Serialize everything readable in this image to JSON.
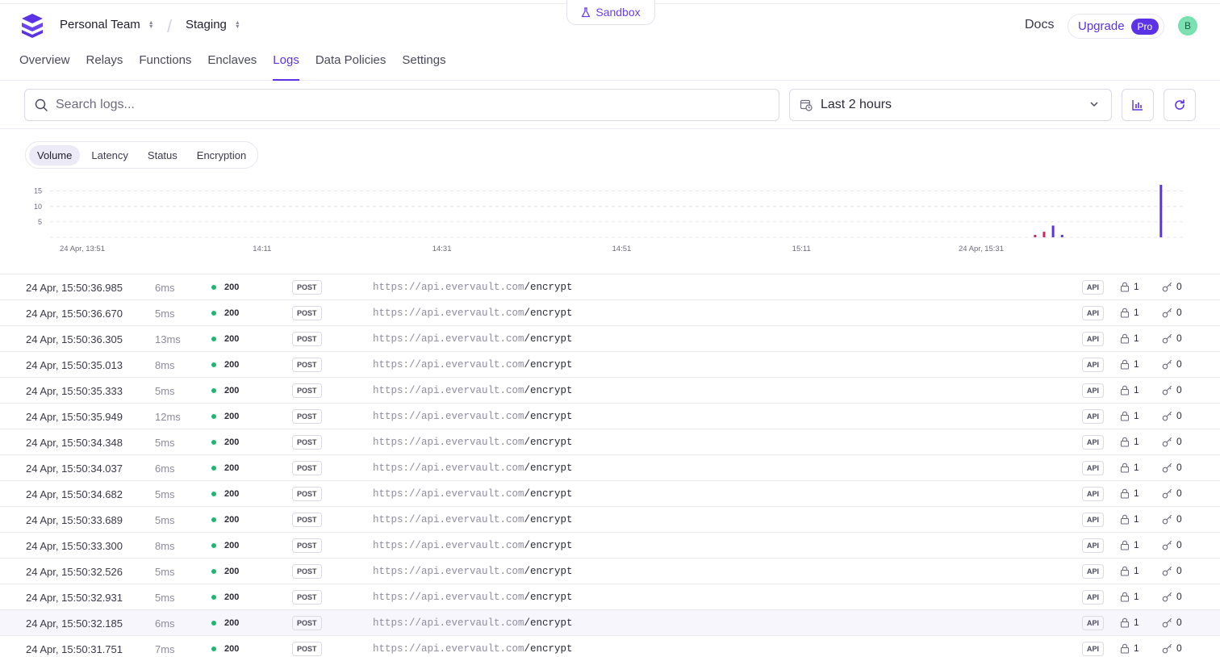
{
  "environment_badge": "Sandbox",
  "header": {
    "team": "Personal Team",
    "separator": "/",
    "env": "Staging",
    "docs": "Docs",
    "upgrade": "Upgrade",
    "pro": "Pro",
    "avatar_initial": "B"
  },
  "nav": {
    "tabs": [
      {
        "label": "Overview"
      },
      {
        "label": "Relays"
      },
      {
        "label": "Functions"
      },
      {
        "label": "Enclaves"
      },
      {
        "label": "Logs"
      },
      {
        "label": "Data Policies"
      },
      {
        "label": "Settings"
      }
    ],
    "active": "Logs"
  },
  "toolbar": {
    "search_placeholder": "Search logs...",
    "range": "Last 2 hours"
  },
  "metric_tabs": {
    "tabs": [
      "Volume",
      "Latency",
      "Status",
      "Encryption"
    ],
    "active": "Volume"
  },
  "chart_data": {
    "type": "bar",
    "y_ticks": [
      "15",
      "10",
      "5"
    ],
    "x_ticks": [
      "24 Apr, 13:51",
      "14:11",
      "14:31",
      "14:51",
      "15:11",
      "24 Apr, 15:31"
    ],
    "ylim": [
      0,
      17
    ],
    "grid": true,
    "colors": {
      "primary": "#5b32e6",
      "error": "#d2255f"
    },
    "bars": [
      {
        "time": "15:37",
        "value": 0.8,
        "color": "error"
      },
      {
        "time": "15:38",
        "value": 1.8,
        "color": "error"
      },
      {
        "time": "15:39",
        "value": 3.8,
        "color": "primary"
      },
      {
        "time": "15:40",
        "value": 0.8,
        "color": "primary"
      },
      {
        "time": "15:51",
        "value": 17,
        "color": "primary"
      }
    ]
  },
  "logs": {
    "host": "https://api.evervault.com",
    "rows": [
      {
        "time": "24 Apr, 15:50:36.985",
        "latency": "6ms",
        "status": "200",
        "method": "POST",
        "path": "/encrypt",
        "source": "API",
        "encrypted": "1",
        "decrypted": "0"
      },
      {
        "time": "24 Apr, 15:50:36.670",
        "latency": "5ms",
        "status": "200",
        "method": "POST",
        "path": "/encrypt",
        "source": "API",
        "encrypted": "1",
        "decrypted": "0"
      },
      {
        "time": "24 Apr, 15:50:36.305",
        "latency": "13ms",
        "status": "200",
        "method": "POST",
        "path": "/encrypt",
        "source": "API",
        "encrypted": "1",
        "decrypted": "0"
      },
      {
        "time": "24 Apr, 15:50:35.013",
        "latency": "8ms",
        "status": "200",
        "method": "POST",
        "path": "/encrypt",
        "source": "API",
        "encrypted": "1",
        "decrypted": "0"
      },
      {
        "time": "24 Apr, 15:50:35.333",
        "latency": "5ms",
        "status": "200",
        "method": "POST",
        "path": "/encrypt",
        "source": "API",
        "encrypted": "1",
        "decrypted": "0"
      },
      {
        "time": "24 Apr, 15:50:35.949",
        "latency": "12ms",
        "status": "200",
        "method": "POST",
        "path": "/encrypt",
        "source": "API",
        "encrypted": "1",
        "decrypted": "0"
      },
      {
        "time": "24 Apr, 15:50:34.348",
        "latency": "5ms",
        "status": "200",
        "method": "POST",
        "path": "/encrypt",
        "source": "API",
        "encrypted": "1",
        "decrypted": "0"
      },
      {
        "time": "24 Apr, 15:50:34.037",
        "latency": "6ms",
        "status": "200",
        "method": "POST",
        "path": "/encrypt",
        "source": "API",
        "encrypted": "1",
        "decrypted": "0"
      },
      {
        "time": "24 Apr, 15:50:34.682",
        "latency": "5ms",
        "status": "200",
        "method": "POST",
        "path": "/encrypt",
        "source": "API",
        "encrypted": "1",
        "decrypted": "0"
      },
      {
        "time": "24 Apr, 15:50:33.689",
        "latency": "5ms",
        "status": "200",
        "method": "POST",
        "path": "/encrypt",
        "source": "API",
        "encrypted": "1",
        "decrypted": "0"
      },
      {
        "time": "24 Apr, 15:50:33.300",
        "latency": "8ms",
        "status": "200",
        "method": "POST",
        "path": "/encrypt",
        "source": "API",
        "encrypted": "1",
        "decrypted": "0"
      },
      {
        "time": "24 Apr, 15:50:32.526",
        "latency": "5ms",
        "status": "200",
        "method": "POST",
        "path": "/encrypt",
        "source": "API",
        "encrypted": "1",
        "decrypted": "0"
      },
      {
        "time": "24 Apr, 15:50:32.931",
        "latency": "5ms",
        "status": "200",
        "method": "POST",
        "path": "/encrypt",
        "source": "API",
        "encrypted": "1",
        "decrypted": "0"
      },
      {
        "time": "24 Apr, 15:50:32.185",
        "latency": "6ms",
        "status": "200",
        "method": "POST",
        "path": "/encrypt",
        "source": "API",
        "encrypted": "1",
        "decrypted": "0",
        "highlighted": true
      },
      {
        "time": "24 Apr, 15:50:31.751",
        "latency": "7ms",
        "status": "200",
        "method": "POST",
        "path": "/encrypt",
        "source": "API",
        "encrypted": "1",
        "decrypted": "0"
      }
    ]
  },
  "icons": {
    "logo": "evervault-logo",
    "sandbox": "flask-icon",
    "search": "search-icon",
    "calendar": "calendar-clock-icon",
    "chevron": "chevron-down-icon",
    "chart_toggle": "bar-chart-icon",
    "refresh": "refresh-icon",
    "lock": "lock-icon",
    "key": "key-icon"
  }
}
